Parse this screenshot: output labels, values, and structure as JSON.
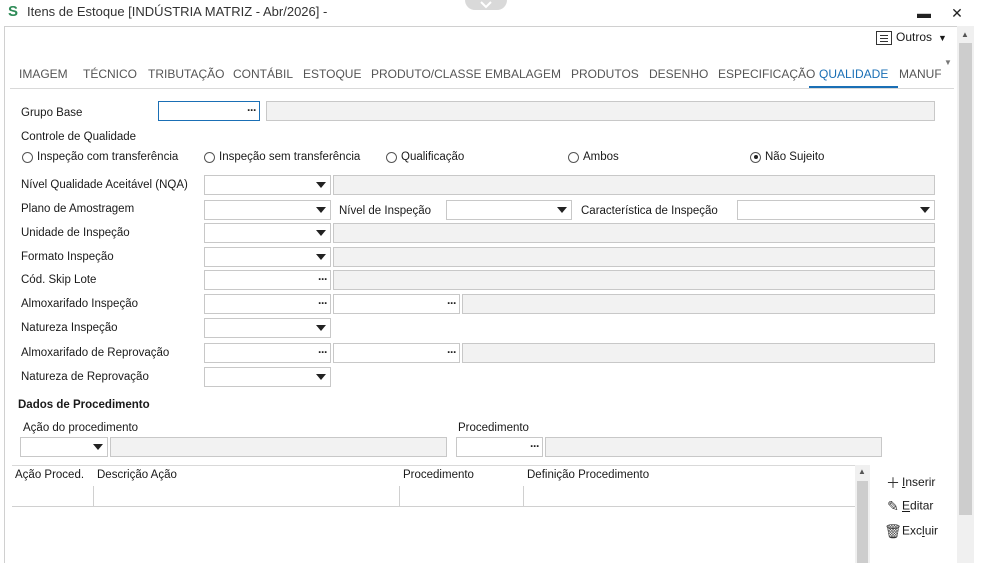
{
  "window": {
    "title": "Itens de Estoque [INDÚSTRIA MATRIZ - Abr/2026]  -",
    "logo": "S",
    "minimize": "▬",
    "close": "✕"
  },
  "toolbar": {
    "outros_label": "Outros"
  },
  "tabs": [
    "IMAGEM",
    "TÉCNICO",
    "TRIBUTAÇÃO",
    "CONTÁBIL",
    "ESTOQUE",
    "PRODUTO/CLASSE",
    "EMBALAGEM",
    "PRODUTOS",
    "DESENHO",
    "ESPECIFICAÇÃO",
    "QUALIDADE",
    "MANUF"
  ],
  "active_tab": "QUALIDADE",
  "form": {
    "grupo_base": "Grupo Base",
    "controle_qualidade": "Controle de Qualidade",
    "radios": {
      "com_transferencia": "Inspeção com transferência",
      "sem_transferencia": "Inspeção sem transferência",
      "qualificacao": "Qualificação",
      "ambos": "Ambos",
      "nao_sujeito": "Não Sujeito"
    },
    "selected_radio": "Não Sujeito",
    "nqa": "Nível Qualidade Aceitável (NQA)",
    "plano_amostragem": "Plano de Amostragem",
    "nivel_inspecao": "Nível de Inspeção",
    "caracteristica_inspecao": "Característica de Inspeção",
    "unidade_inspecao": "Unidade de Inspeção",
    "formato_inspecao": "Formato Inspeção",
    "skip_lote": "Cód. Skip Lote",
    "almox_inspecao": "Almoxarifado Inspeção",
    "natureza_inspecao": "Natureza Inspeção",
    "almox_reprovacao": "Almoxarifado de Reprovação",
    "natureza_reprovacao": "Natureza de Reprovação",
    "dados_procedimento": "Dados de Procedimento",
    "acao_procedimento": "Ação do procedimento",
    "procedimento": "Procedimento"
  },
  "grid": {
    "columns": [
      "Ação Proced.",
      "Descrição Ação",
      "Procedimento",
      "Definição Procedimento"
    ],
    "rows": []
  },
  "actions": {
    "inserir_pre": "",
    "inserir_ul": "I",
    "inserir_post": "nserir",
    "editar_pre": "",
    "editar_ul": "E",
    "editar_post": "ditar",
    "excluir_pre": "Exc",
    "excluir_ul": "l",
    "excluir_post": "uir"
  },
  "icons": {
    "outros": "list-icon",
    "inserir": "plus-icon",
    "editar": "edit-icon",
    "excluir": "trash-icon",
    "lookup": "ellipsis-icon",
    "dropdown": "caret-down-icon"
  }
}
